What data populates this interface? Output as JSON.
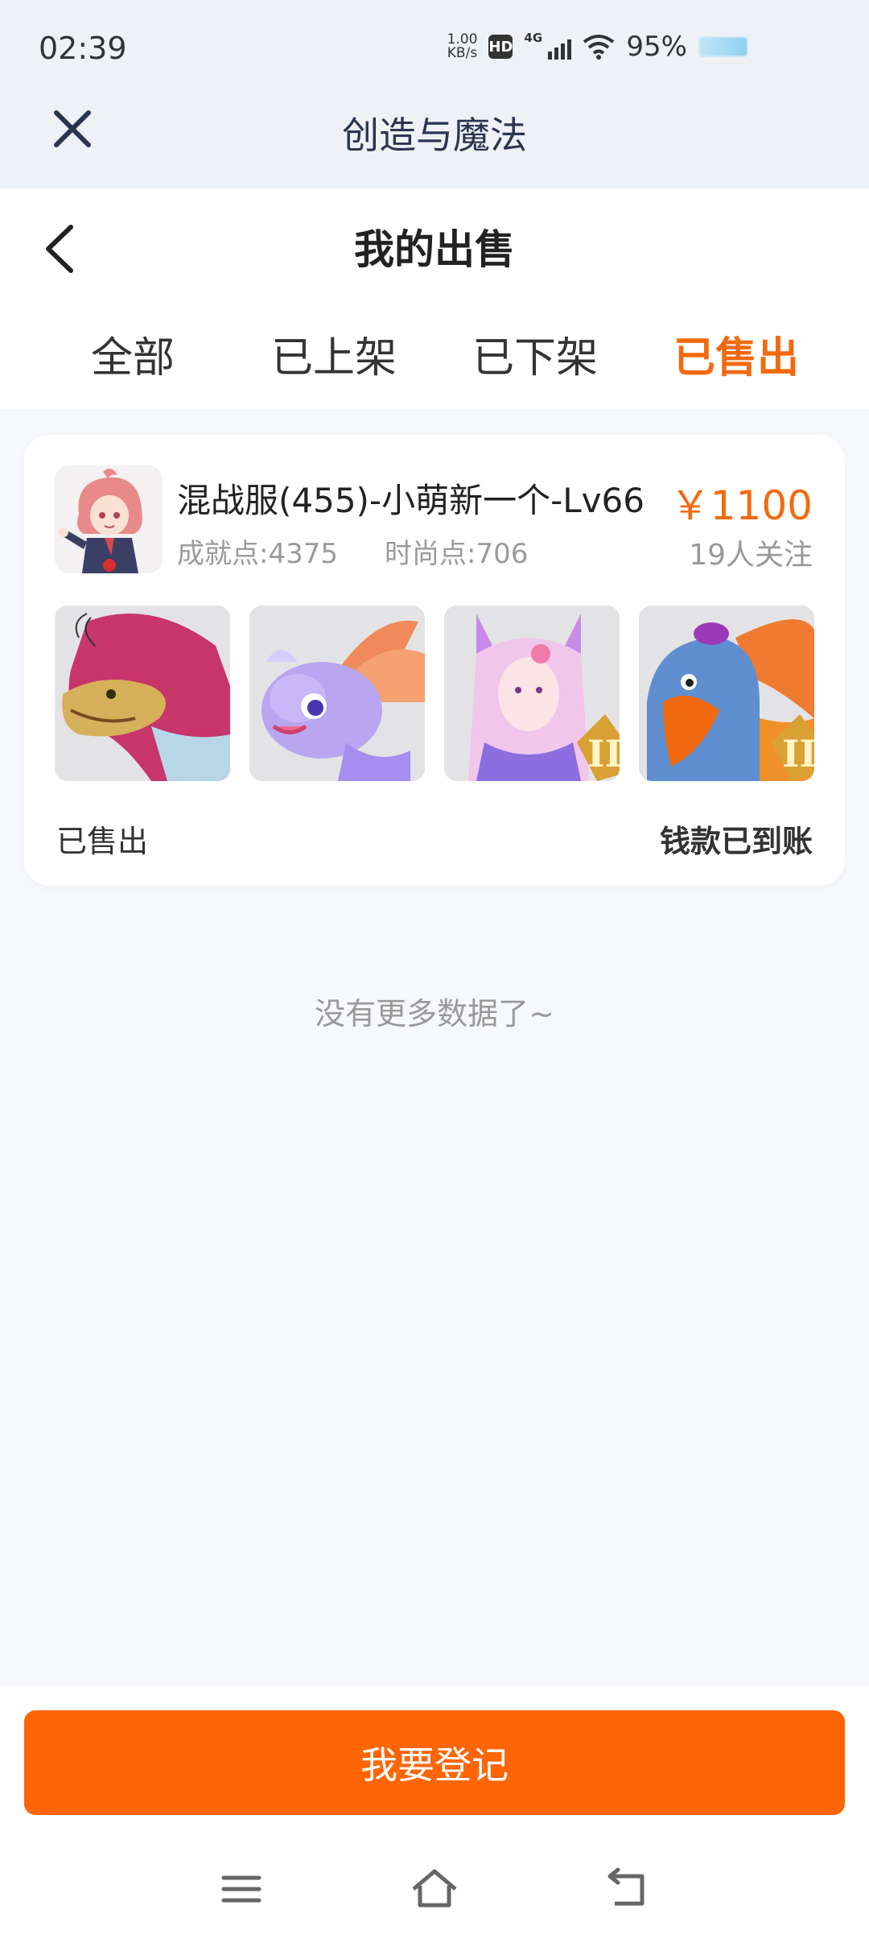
{
  "status_bar": {
    "time": "02:39",
    "net_speed_value": "1.00",
    "net_speed_unit": "KB/s",
    "hd": "HD",
    "network": "4G",
    "battery": "95%"
  },
  "web_header": {
    "title": "创造与魔法"
  },
  "page": {
    "title": "我的出售"
  },
  "tabs": [
    {
      "label": "全部",
      "active": false
    },
    {
      "label": "已上架",
      "active": false
    },
    {
      "label": "已下架",
      "active": false
    },
    {
      "label": "已售出",
      "active": true
    }
  ],
  "listing": {
    "title": "混战服(455)-小萌新一个-Lv66",
    "achievement": "成就点:4375",
    "fashion": "时尚点:706",
    "price": "￥1100",
    "followers": "19人关注",
    "thumbnails": [
      "dragon-mount-image",
      "purple-dragon-pet-image",
      "fox-spirit-image",
      "eagle-mount-image"
    ],
    "status": "已售出",
    "payment_status": "钱款已到账"
  },
  "no_more_text": "没有更多数据了~",
  "register_button": "我要登记",
  "colors": {
    "accent": "#f26a10",
    "button": "#fd6506",
    "page_bg": "#f6f8fb"
  }
}
